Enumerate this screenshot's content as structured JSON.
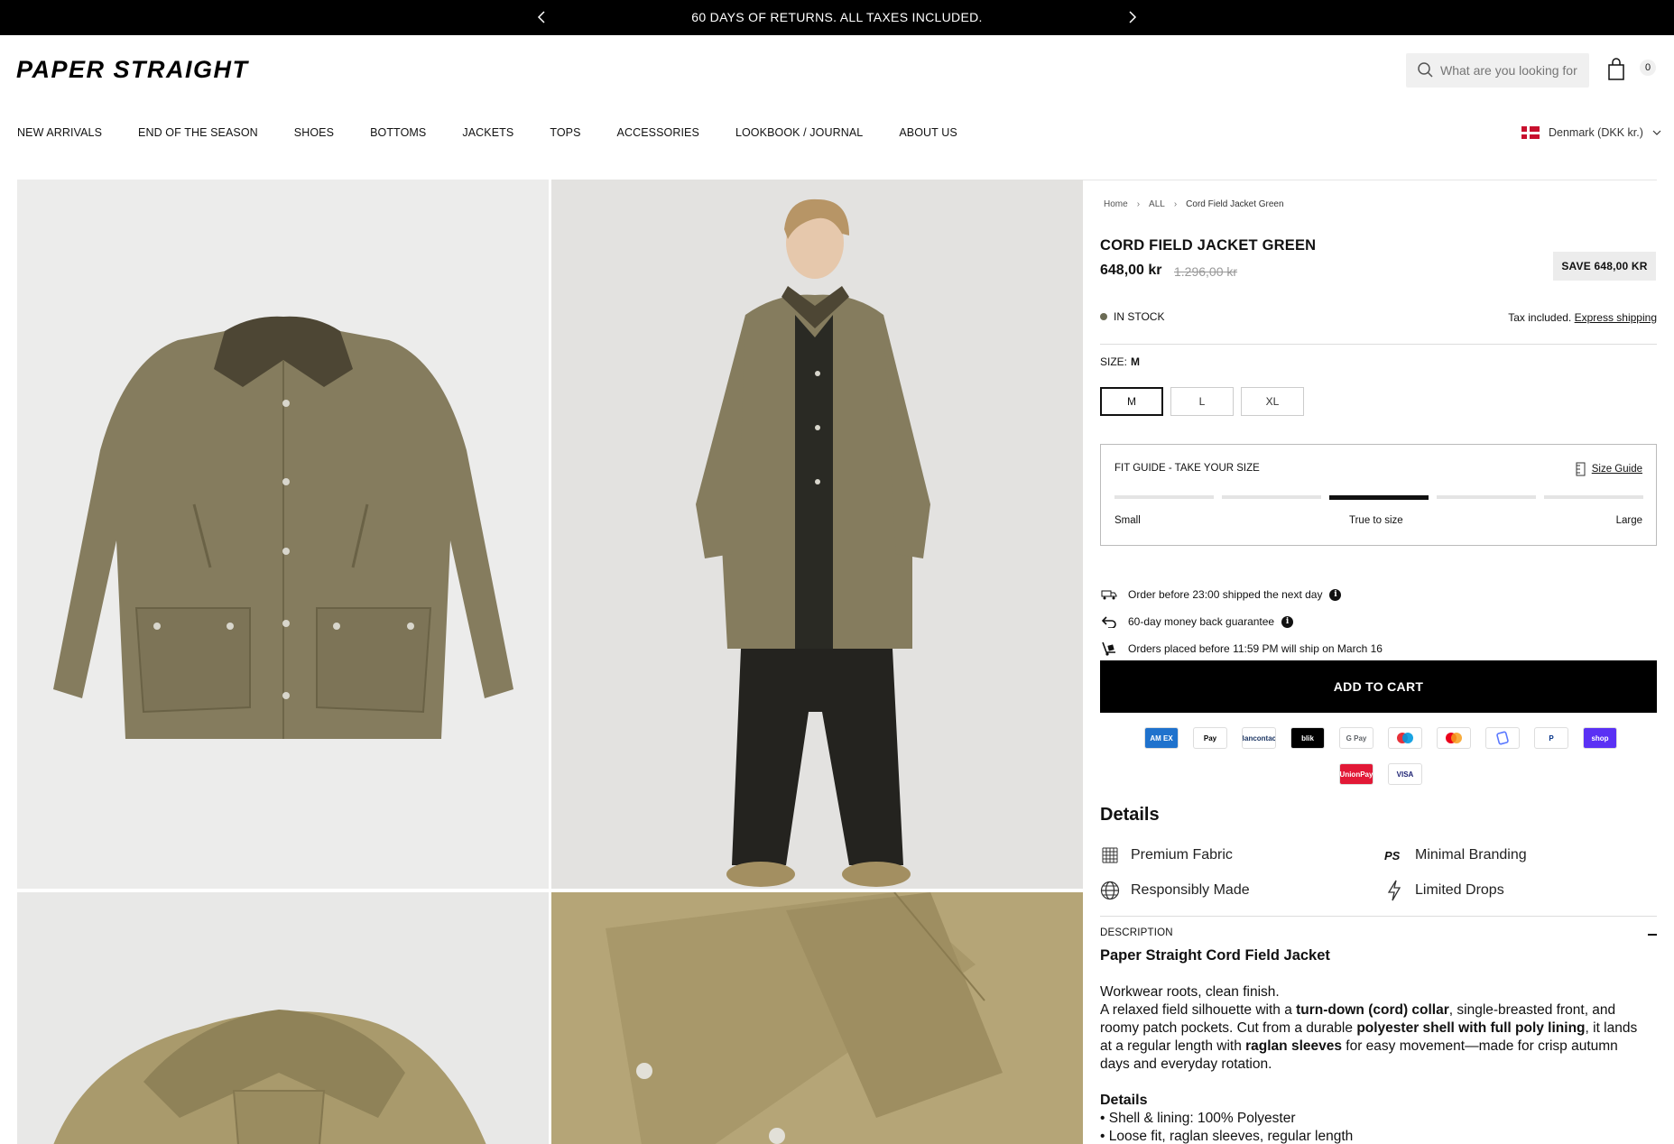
{
  "announcement": {
    "message": "60 DAYS OF RETURNS. ALL TAXES INCLUDED."
  },
  "header": {
    "logo": "PAPER STRAIGHT",
    "search_placeholder": "What are you looking for",
    "cart_count": "0"
  },
  "nav": {
    "items": [
      "NEW ARRIVALS",
      "END OF THE SEASON",
      "SHOES",
      "BOTTOMS",
      "JACKETS",
      "TOPS",
      "ACCESSORIES",
      "LOOKBOOK / JOURNAL",
      "ABOUT US"
    ],
    "locale": "Denmark (DKK kr.)"
  },
  "breadcrumb": [
    "Home",
    "ALL",
    "Cord Field Jacket Green"
  ],
  "product": {
    "title": "CORD FIELD JACKET GREEN",
    "price": "648,00 kr",
    "compare_price": "1.296,00 kr",
    "save_badge": "SAVE 648,00 KR",
    "stock": "IN STOCK",
    "tax_text": "Tax included.",
    "shipping_link": "Express shipping",
    "size_label": "SIZE:",
    "selected_size": "M",
    "sizes": [
      "M",
      "L",
      "XL"
    ],
    "add_to_cart": "ADD TO CART"
  },
  "fit_guide": {
    "title": "FIT GUIDE - TAKE YOUR SIZE",
    "size_guide_link": "Size Guide",
    "level_index": 2,
    "level_count": 5,
    "labels": {
      "small": "Small",
      "true": "True to size",
      "large": "Large"
    }
  },
  "perks": [
    {
      "icon": "truck-icon",
      "text": "Order before 23:00 shipped the next day"
    },
    {
      "icon": "return-icon",
      "text": "60-day money back guarantee"
    },
    {
      "icon": "dolly-icon",
      "text": "Orders placed before 11:59 PM will ship on March 16"
    }
  ],
  "payments": [
    {
      "name": "amex-icon",
      "label": "AM EX",
      "bg": "#1f72cd",
      "fg": "#ffffff"
    },
    {
      "name": "apple-pay-icon",
      "label": "Pay",
      "bg": "#ffffff",
      "fg": "#000000"
    },
    {
      "name": "bancontact-icon",
      "label": "Bancontact",
      "bg": "#ffffff",
      "fg": "#1e3764"
    },
    {
      "name": "blik-icon",
      "label": "blik",
      "bg": "#000000",
      "fg": "#ffffff"
    },
    {
      "name": "google-pay-icon",
      "label": "G Pay",
      "bg": "#ffffff",
      "fg": "#5f6368"
    },
    {
      "name": "maestro-icon",
      "label": "",
      "bg": "#ffffff",
      "fg": "#000000"
    },
    {
      "name": "mastercard-icon",
      "label": "",
      "bg": "#ffffff",
      "fg": "#000000"
    },
    {
      "name": "mobilepay-icon",
      "label": "",
      "bg": "#ffffff",
      "fg": "#5a78ff"
    },
    {
      "name": "paypal-icon",
      "label": "P",
      "bg": "#ffffff",
      "fg": "#003087"
    },
    {
      "name": "shop-pay-icon",
      "label": "shop",
      "bg": "#5a31f4",
      "fg": "#ffffff"
    },
    {
      "name": "unionpay-icon",
      "label": "UnionPay",
      "bg": "#e21836",
      "fg": "#ffffff"
    },
    {
      "name": "visa-icon",
      "label": "VISA",
      "bg": "#ffffff",
      "fg": "#1a1f71"
    }
  ],
  "details": {
    "title": "Details",
    "features": [
      {
        "icon": "fabric-icon",
        "text": "Premium Fabric"
      },
      {
        "icon": "ps-logo-icon",
        "text": "Minimal Branding"
      },
      {
        "icon": "globe-icon",
        "text": "Responsibly Made"
      },
      {
        "icon": "lightning-icon",
        "text": "Limited Drops"
      }
    ]
  },
  "description": {
    "label": "DESCRIPTION",
    "title": "Paper Straight Cord Field Jacket",
    "intro": "Workwear roots, clean finish.",
    "p1_a": "A relaxed field silhouette with a ",
    "p1_b": "turn-down (cord) collar",
    "p1_c": ", single-breasted front, and roomy patch pockets. Cut from a durable ",
    "p1_d": "polyester shell with full poly lining",
    "p1_e": ", it lands at a regular length with ",
    "p1_f": "raglan sleeves",
    "p1_g": " for easy movement—made for crisp autumn days and everyday rotation.",
    "details_heading": "Details",
    "bullets": [
      "• Shell & lining: 100% Polyester",
      "• Loose fit, raglan sleeves, regular length"
    ]
  },
  "colors": {
    "jacket": "#857c5e",
    "collar": "#4d4634",
    "detail_bg": "#b5a577"
  }
}
